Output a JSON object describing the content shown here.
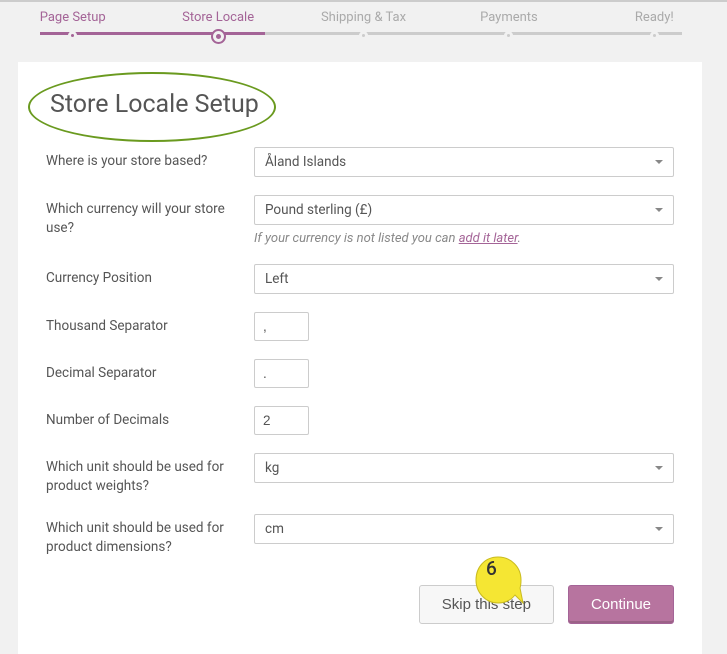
{
  "steps": {
    "s0": "Page Setup",
    "s1": "Store Locale",
    "s2": "Shipping & Tax",
    "s3": "Payments",
    "s4": "Ready!"
  },
  "title": "Store Locale Setup",
  "form": {
    "store_based_label": "Where is your store based?",
    "store_based_value": "Åland Islands",
    "currency_label": "Which currency will your store use?",
    "currency_value": "Pound sterling (£)",
    "currency_hint_prefix": "If your currency is not listed you can ",
    "currency_hint_link": "add it later",
    "currency_hint_suffix": ".",
    "position_label": "Currency Position",
    "position_value": "Left",
    "thousand_label": "Thousand Separator",
    "thousand_value": ",",
    "decimal_label": "Decimal Separator",
    "decimal_value": ".",
    "numdec_label": "Number of Decimals",
    "numdec_value": "2",
    "weight_label": "Which unit should be used for product weights?",
    "weight_value": "kg",
    "dimension_label": "Which unit should be used for product dimensions?",
    "dimension_value": "cm"
  },
  "actions": {
    "skip": "Skip this step",
    "continue": "Continue"
  },
  "annotation": {
    "num": "6"
  }
}
